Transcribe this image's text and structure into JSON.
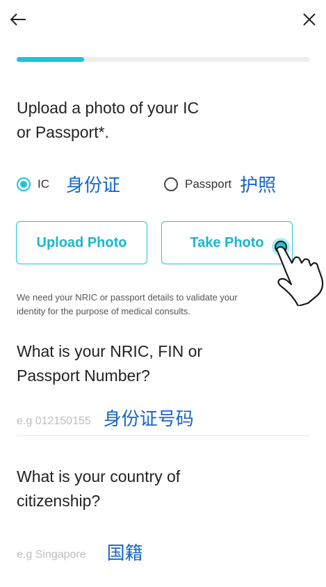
{
  "header": {
    "back_icon": "arrow-left-icon",
    "close_icon": "close-icon"
  },
  "progress": {
    "fraction": 0.23,
    "color": "#1ec4d6"
  },
  "upload": {
    "question_line1": "Upload a photo of your IC",
    "question_line2": "or Passport*.",
    "options": [
      {
        "label": "IC",
        "annotation": "身份证",
        "selected": true
      },
      {
        "label": "Passport",
        "annotation": "护照",
        "selected": false
      }
    ],
    "upload_button": "Upload Photo",
    "take_button": "Take Photo",
    "note_line1": "We need your NRIC or passport details to validate your",
    "note_line2": "identity for the purpose of medical consults."
  },
  "nric": {
    "question_line1": "What is your NRIC, FIN or",
    "question_line2": "Passport Number?",
    "placeholder": "e.g 012150155",
    "annotation": "身份证号码"
  },
  "citizenship": {
    "question_line1": "What is your country of",
    "question_line2": "citizenship?",
    "placeholder": "e.g Singapore",
    "annotation": "国籍"
  },
  "colors": {
    "accent": "#1ec4d6",
    "annotation": "#1766c7"
  }
}
